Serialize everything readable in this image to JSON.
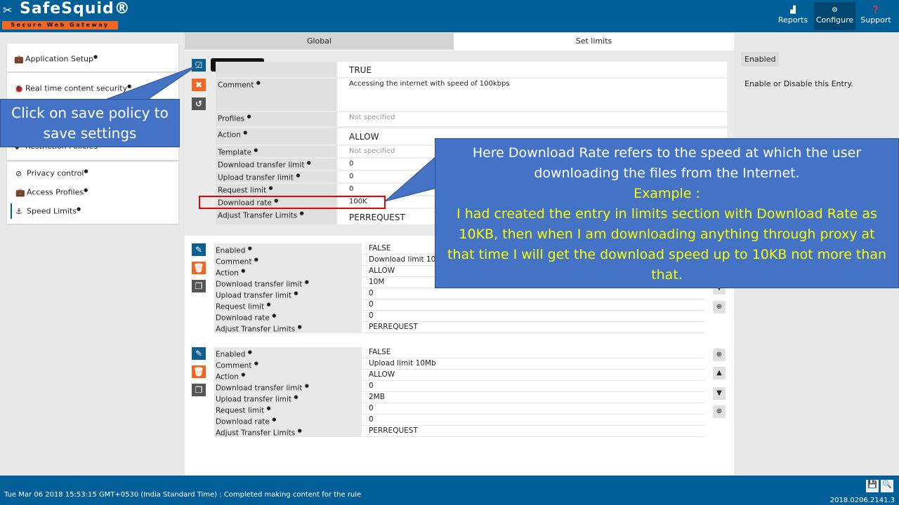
{
  "brand": {
    "name": "SafeSquid®",
    "tagline": "Secure Web Gateway"
  },
  "topnav": [
    {
      "label": "Reports",
      "icon": "chart-icon"
    },
    {
      "label": "Configure",
      "icon": "cogs-icon",
      "active": true
    },
    {
      "label": "Support",
      "icon": "help-icon"
    }
  ],
  "sidebar": {
    "items": [
      {
        "label": "Application Setup",
        "icon": "briefcase-icon"
      },
      {
        "label": "Real time content security",
        "icon": "bug-icon"
      },
      {
        "label": "Restriction Policies",
        "icon": "shield-icon"
      },
      {
        "label": "Privacy control",
        "icon": "ban-icon"
      },
      {
        "label": "Access Profiles",
        "icon": "briefcase-icon"
      },
      {
        "label": "Speed Limits",
        "icon": "speed-icon",
        "active": true
      }
    ]
  },
  "tabs": [
    {
      "label": "Global"
    },
    {
      "label": "Set limits",
      "active": true
    }
  ],
  "tooltip": "Save Policy",
  "edit_form": {
    "enabled": "TRUE",
    "rows": [
      {
        "label": "Comment",
        "value": "Accessing the internet with speed of 100kbps"
      },
      {
        "label": "Profiles",
        "value": "Not specified"
      },
      {
        "label": "Action",
        "value": "ALLOW"
      },
      {
        "label": "Template",
        "value": "Not specified"
      },
      {
        "label": "Download transfer limit",
        "value": "0"
      },
      {
        "label": "Upload transfer limit",
        "value": "0"
      },
      {
        "label": "Request limit",
        "value": "0"
      },
      {
        "label": "Download rate",
        "value": "100K"
      },
      {
        "label": "Adjust Transfer Limits",
        "value": "PERREQUEST"
      }
    ]
  },
  "entries": [
    {
      "rows": [
        {
          "label": "Enabled",
          "value": "FALSE"
        },
        {
          "label": "Comment",
          "value": "Download limit 10M"
        },
        {
          "label": "Action",
          "value": "ALLOW"
        },
        {
          "label": "Download transfer limit",
          "value": "10M"
        },
        {
          "label": "Upload transfer limit",
          "value": "0"
        },
        {
          "label": "Request limit",
          "value": "0"
        },
        {
          "label": "Download rate",
          "value": "0"
        },
        {
          "label": "Adjust Transfer Limits",
          "value": "PERREQUEST"
        }
      ]
    },
    {
      "rows": [
        {
          "label": "Enabled",
          "value": "FALSE"
        },
        {
          "label": "Comment",
          "value": "Upload limit 10Mb"
        },
        {
          "label": "Action",
          "value": "ALLOW"
        },
        {
          "label": "Download transfer limit",
          "value": "0"
        },
        {
          "label": "Upload transfer limit",
          "value": "2MB"
        },
        {
          "label": "Request limit",
          "value": "0"
        },
        {
          "label": "Download rate",
          "value": "0"
        },
        {
          "label": "Adjust Transfer Limits",
          "value": "PERREQUEST"
        }
      ]
    }
  ],
  "help": {
    "title": "Enabled",
    "text": "Enable or Disable this Entry."
  },
  "callouts": {
    "save": "Click on save policy to save settings",
    "rate_line1": "Here Download Rate refers to the speed at which the user downloading the files from the Internet.",
    "rate_example": "Example :",
    "rate_line2": "I had created the entry in limits section with Download Rate as 10KB, then when I am downloading anything through proxy at that time I will get the download speed up to 10KB not more than that."
  },
  "footer": {
    "status": "Tue Mar 06 2018 15:53:15 GMT+0530 (India Standard Time) : Completed making content for the rule",
    "version": "2018.0206.2141.3"
  },
  "colors": {
    "brand": "#005f96",
    "accent": "#f26522",
    "callout": "#4472c4",
    "callout_highlight": "#ffff00"
  }
}
